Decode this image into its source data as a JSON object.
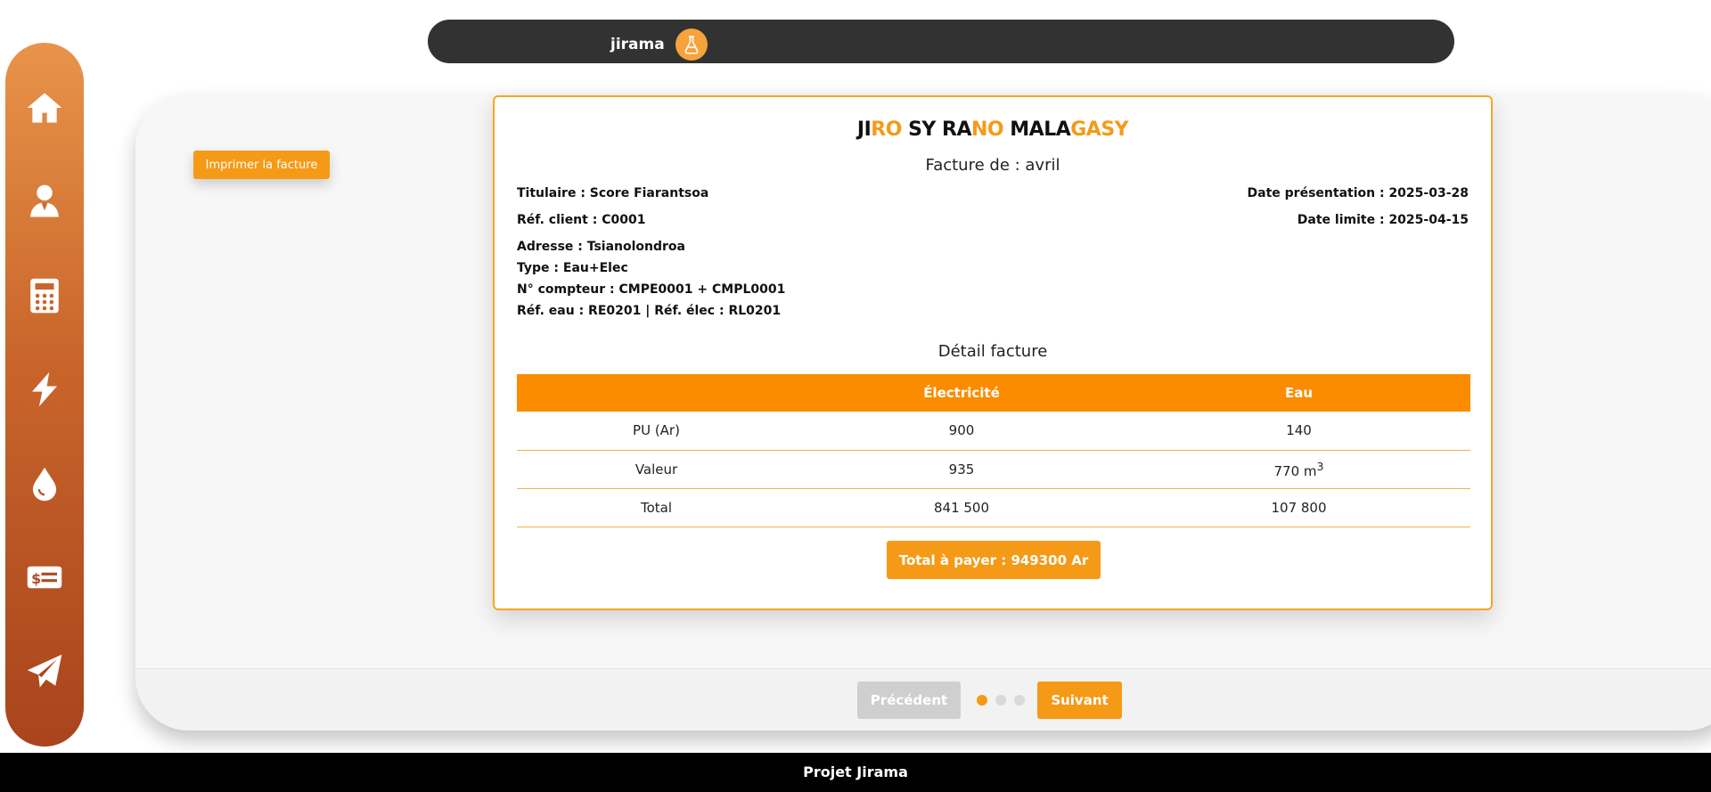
{
  "nav": {
    "items": [
      {
        "name": "home",
        "icon": "home-icon"
      },
      {
        "name": "user",
        "icon": "user-tie-icon"
      },
      {
        "name": "calculator",
        "icon": "calculator-icon"
      },
      {
        "name": "electricity",
        "icon": "bolt-icon"
      },
      {
        "name": "water",
        "icon": "water-drop-icon"
      },
      {
        "name": "billing",
        "icon": "money-bill-list-icon"
      },
      {
        "name": "send",
        "icon": "paper-plane-icon"
      }
    ]
  },
  "topbar": {
    "brand": "jirama",
    "logo_icon": "lab-flask-icon"
  },
  "actions": {
    "print_label": "Imprimer la facture"
  },
  "invoice": {
    "title": {
      "p1": "JI",
      "p2": "RO",
      "p3": " SY RA",
      "p4": "NO",
      "p5": " MALA",
      "p6": "GASY"
    },
    "subtitle": "Facture de : avril",
    "holder": "Titulaire : Score Fiarantsoa",
    "client_ref": "Réf. client : C0001",
    "address": "Adresse : Tsianolondroa",
    "type": "Type : Eau+Elec",
    "meter": "N° compteur : CMPE0001 + CMPL0001",
    "refs": "Réf. eau : RE0201 | Réf. élec : RL0201",
    "date_presentation": "Date présentation : 2025-03-28",
    "date_limit": "Date limite : 2025-04-15",
    "detail_title": "Détail facture",
    "table": {
      "headers": [
        "",
        "Électricité",
        "Eau"
      ],
      "rows": [
        {
          "label": "PU (Ar)",
          "elec": "900",
          "water": "140"
        },
        {
          "label": "Valeur",
          "elec": "935",
          "water": "770 m",
          "water_sup": "3"
        },
        {
          "label": "Total",
          "elec": "841 500",
          "water": "107 800"
        }
      ]
    },
    "total_label": "Total à payer : 949300 Ar"
  },
  "pager": {
    "prev_label": "Précédent",
    "next_label": "Suivant",
    "dots": 3,
    "active_dot": 1
  },
  "footer": {
    "text": "Projet Jirama"
  },
  "colors": {
    "accent": "#f59a17",
    "table_header": "#fb8c00",
    "topbar": "#323232",
    "sidebar_top": "#e8934a",
    "sidebar_bottom": "#a9441d"
  }
}
